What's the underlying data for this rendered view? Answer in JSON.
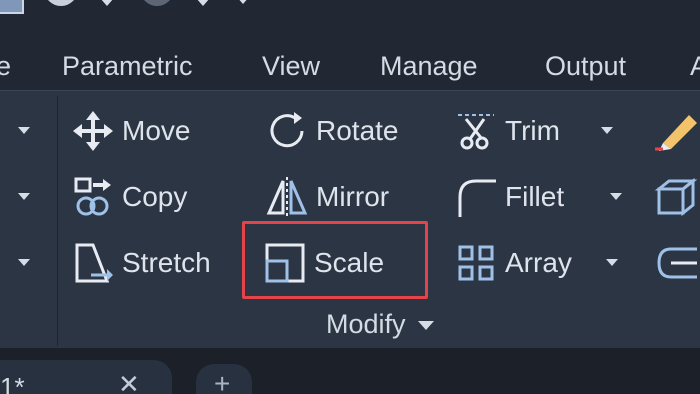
{
  "tabs": {
    "partial_left": "e",
    "parametric": "Parametric",
    "view": "View",
    "manage": "Manage",
    "output": "Output",
    "partial_right": "A"
  },
  "modify": {
    "move": "Move",
    "rotate": "Rotate",
    "trim": "Trim",
    "copy": "Copy",
    "mirror": "Mirror",
    "fillet": "Fillet",
    "stretch": "Stretch",
    "scale": "Scale",
    "array": "Array",
    "panel_title": "Modify"
  },
  "document_tabs": {
    "current_label": "1*",
    "close_glyph": "✕",
    "new_tab_glyph": "+"
  },
  "colors": {
    "ribbon_bg": "#2c3544",
    "tabbar_bg": "#212833",
    "highlight": "#e5434a",
    "text": "#dfe4ec"
  }
}
